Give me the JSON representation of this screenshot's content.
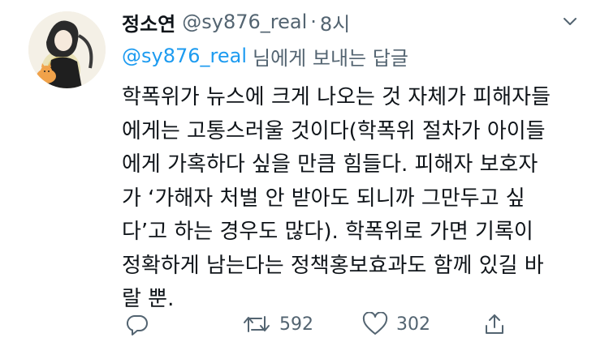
{
  "tweet": {
    "display_name": "정소연",
    "handle": "@sy876_real",
    "separator": "·",
    "time": "8시",
    "reply_to": {
      "mention": "@sy876_real",
      "suffix": "님에게 보내는 답글"
    },
    "body_lines": [
      "학폭위가 뉴스에 크게 나오는 것 자체가 피해자들",
      "에게는 고통스러울 것이다(학폭위 절차가 아이들",
      "에게 가혹하다 싶을 만큼 힘들다. 피해자 보호자",
      "가 ‘가해자 처벌 안 받아도 되니까 그만두고 싶",
      "다’고 하는 경우도 많다). 학폭위로 가면 기록이",
      "정확하게 남는다는 정책홍보효과도 함께 있길 바",
      "랄 뿐."
    ],
    "actions": {
      "retweets": "592",
      "likes": "302"
    }
  },
  "icons": {
    "more": "chevron-down-icon",
    "reply": "reply-icon",
    "retweet": "retweet-icon",
    "like": "heart-icon",
    "share": "share-icon"
  },
  "colors": {
    "text": "#0f1419",
    "secondary": "#536471",
    "accent": "#1d9bf0",
    "icon": "#536471"
  }
}
